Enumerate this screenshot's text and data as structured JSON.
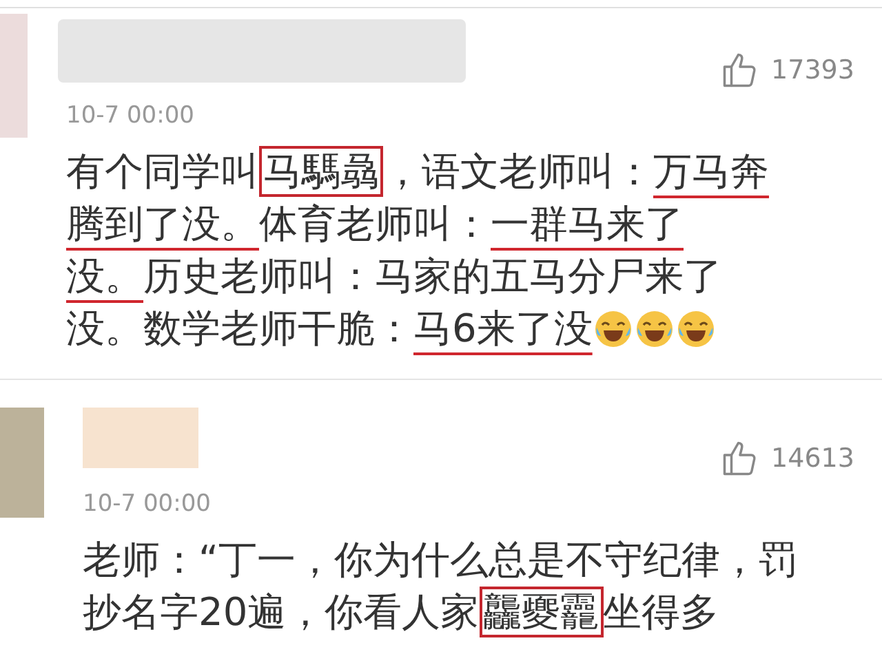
{
  "comments": [
    {
      "likes": "17393",
      "time": "10-7 00:00",
      "lines": [
        [
          {
            "kind": "plain",
            "text": "有个同学叫"
          },
          {
            "kind": "boxed",
            "text": "马騳骉"
          },
          {
            "kind": "plain",
            "text": "，语文老师叫："
          },
          {
            "kind": "underlined",
            "text": "万马奔"
          }
        ],
        [
          {
            "kind": "underlined",
            "text": "腾到了没。"
          },
          {
            "kind": "plain",
            "text": "体育老师叫："
          },
          {
            "kind": "underlined",
            "text": "一群马来了"
          }
        ],
        [
          {
            "kind": "underlined",
            "text": "没。"
          },
          {
            "kind": "plain",
            "text": "历史老师叫：马家的五马分尸来了"
          }
        ],
        [
          {
            "kind": "plain",
            "text": "没。数学老师干脆："
          },
          {
            "kind": "underlined",
            "text": "马6来了没"
          },
          {
            "kind": "emoji"
          },
          {
            "kind": "emoji"
          },
          {
            "kind": "emoji"
          }
        ]
      ]
    },
    {
      "likes": "14613",
      "time": "10-7 00:00",
      "lines": [
        [
          {
            "kind": "plain",
            "text": "老师：“丁一，你为什么总是不守纪律，罚"
          }
        ],
        [
          {
            "kind": "plain",
            "text": "抄名字20遍，你看人家"
          },
          {
            "kind": "boxed",
            "text": "龘夒龗"
          },
          {
            "kind": "plain",
            "text": "坐得多"
          }
        ]
      ]
    }
  ]
}
